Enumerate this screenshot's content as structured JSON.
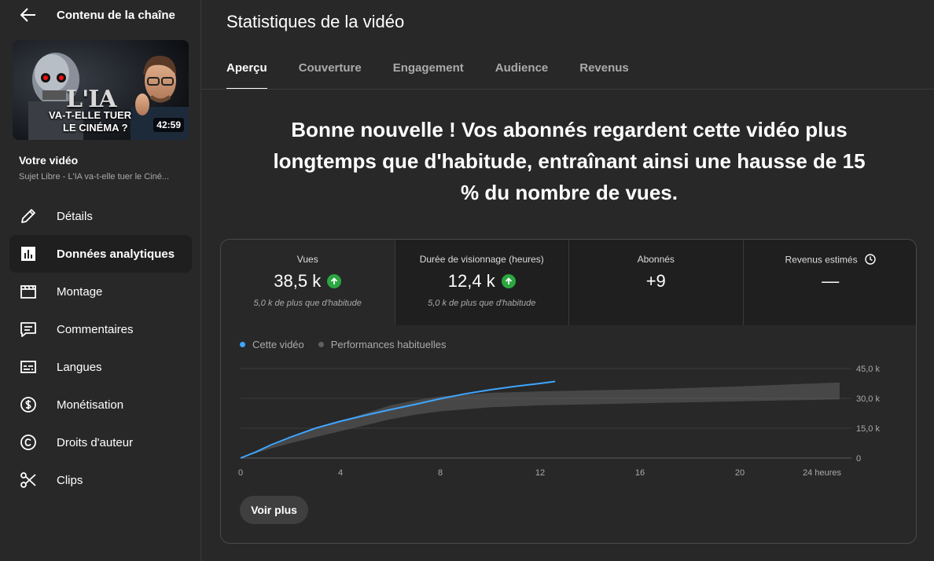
{
  "sidebar": {
    "title": "Contenu de la chaîne",
    "video": {
      "duration": "42:59",
      "thumb_line1": "L'IA",
      "thumb_line2": "VA-T-ELLE TUER",
      "thumb_line3": "LE CINÉMA ?",
      "label": "Votre vidéo",
      "subtitle": "Sujet Libre - L'IA va-t-elle tuer le Ciné..."
    },
    "items": [
      {
        "label": "Détails",
        "icon": "pencil-icon"
      },
      {
        "label": "Données analytiques",
        "icon": "analytics-icon",
        "active": true
      },
      {
        "label": "Montage",
        "icon": "clapperboard-icon"
      },
      {
        "label": "Commentaires",
        "icon": "comment-icon"
      },
      {
        "label": "Langues",
        "icon": "subtitles-icon"
      },
      {
        "label": "Monétisation",
        "icon": "dollar-icon"
      },
      {
        "label": "Droits d'auteur",
        "icon": "copyright-icon"
      },
      {
        "label": "Clips",
        "icon": "scissors-icon"
      }
    ]
  },
  "main": {
    "title": "Statistiques de la vidéo",
    "tabs": [
      {
        "label": "Aperçu",
        "active": true
      },
      {
        "label": "Couverture"
      },
      {
        "label": "Engagement"
      },
      {
        "label": "Audience"
      },
      {
        "label": "Revenus"
      }
    ],
    "headline": "Bonne nouvelle ! Vos abonnés regardent cette vidéo plus longtemps que d'habitude, entraînant ainsi une hausse de 15 % du nombre de vues."
  },
  "metrics": [
    {
      "label": "Vues",
      "value": "38,5 k",
      "trend": "up",
      "sub": "5,0 k de plus que d'habitude"
    },
    {
      "label": "Durée de visionnage (heures)",
      "value": "12,4 k",
      "trend": "up",
      "sub": "5,0 k de plus que d'habitude"
    },
    {
      "label": "Abonnés",
      "value": "+9",
      "trend": "",
      "sub": ""
    },
    {
      "label": "Revenus estimés",
      "value": "—",
      "trend": "",
      "sub": "",
      "icon": "clock-icon"
    }
  ],
  "legend": {
    "current": "Cette vidéo",
    "typical": "Performances habituelles"
  },
  "colors": {
    "current": "#3ea6ff",
    "typical": "#606060",
    "up": "#2ba640"
  },
  "chart_data": {
    "type": "line",
    "xlabel": "",
    "ylabel": "",
    "x_ticks": [
      "0",
      "4",
      "8",
      "12",
      "16",
      "20",
      "24 heures"
    ],
    "y_ticks": [
      "0",
      "15,0 k",
      "30,0 k",
      "45,0 k"
    ],
    "xlim": [
      0,
      24
    ],
    "ylim": [
      0,
      45000
    ],
    "series": [
      {
        "name": "Cette vidéo",
        "x": [
          0,
          0.6,
          1.2,
          2,
          3,
          4,
          5,
          6,
          7,
          8,
          9,
          10,
          11,
          12,
          12.6
        ],
        "y": [
          0,
          3000,
          6500,
          10500,
          15000,
          18500,
          21500,
          24300,
          27000,
          29800,
          32300,
          34300,
          36000,
          37500,
          38500
        ]
      }
    ],
    "typical_band": {
      "name": "Performances habituelles",
      "x": [
        0,
        1,
        2,
        3,
        4,
        5,
        6,
        7,
        8,
        10,
        12,
        16,
        20,
        24
      ],
      "low": [
        0,
        4000,
        7500,
        10500,
        13500,
        16500,
        19500,
        21800,
        23500,
        25500,
        26500,
        27500,
        28500,
        29500
      ],
      "high": [
        0,
        5000,
        10000,
        14500,
        18500,
        22500,
        26500,
        29000,
        31000,
        32800,
        33500,
        34500,
        36000,
        38000
      ]
    }
  },
  "more_button": "Voir plus"
}
